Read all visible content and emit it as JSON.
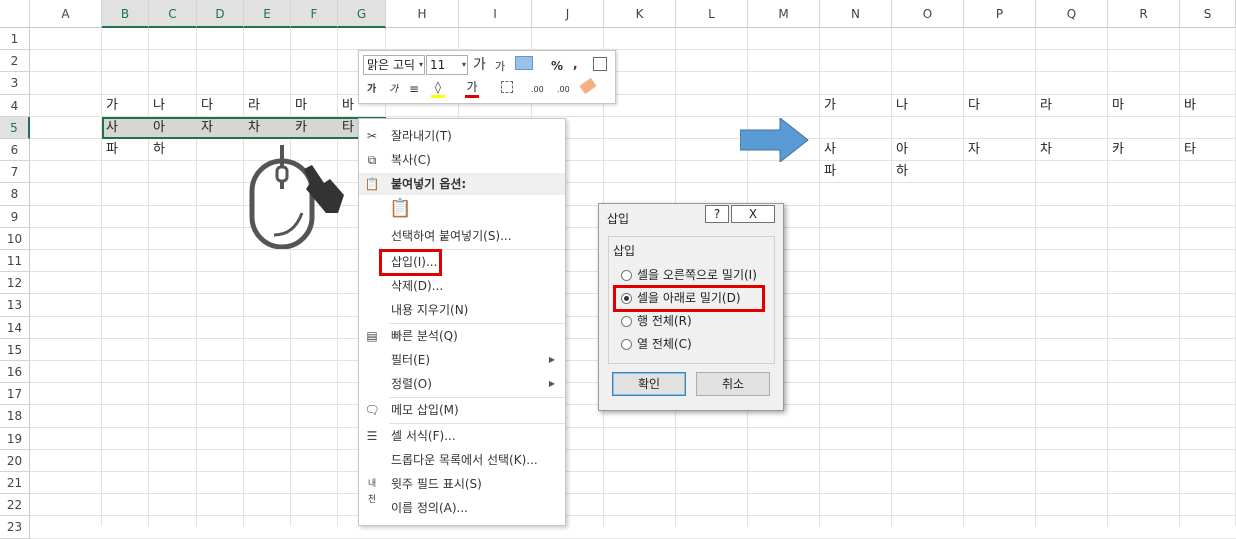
{
  "columns": [
    "A",
    "B",
    "C",
    "D",
    "E",
    "F",
    "G",
    "H",
    "I",
    "J",
    "K",
    "L",
    "M",
    "N",
    "O",
    "P",
    "Q",
    "R",
    "S"
  ],
  "rows": [
    "1",
    "2",
    "3",
    "4",
    "5",
    "6",
    "7",
    "8",
    "9",
    "10",
    "11",
    "12",
    "13",
    "14",
    "15",
    "16",
    "17",
    "18",
    "19",
    "20",
    "21",
    "22",
    "23"
  ],
  "left_data": {
    "row4": [
      "가",
      "나",
      "다",
      "라",
      "마",
      "바"
    ],
    "row5": [
      "사",
      "아",
      "자",
      "차",
      "카",
      "타"
    ],
    "row6": [
      "파",
      "하"
    ]
  },
  "right_data": {
    "row4": [
      "가",
      "나",
      "다",
      "라",
      "마",
      "바"
    ],
    "row6": [
      "사",
      "아",
      "자",
      "차",
      "카",
      "타"
    ],
    "row7": [
      "파",
      "하"
    ]
  },
  "mini_toolbar": {
    "font": "맑은 고딕",
    "size": "11",
    "grow": "가",
    "shrink": "가",
    "percent": "%",
    "comma": ",",
    "bold": "가",
    "italic": "가",
    "fontcolor": "가",
    "dec_inc": ".00",
    "dec_dec": ".00"
  },
  "context_menu": {
    "cut": "잘라내기(T)",
    "copy": "복사(C)",
    "paste_header": "붙여넣기 옵션:",
    "paste_special": "선택하여 붙여넣기(S)...",
    "insert": "삽입(I)...",
    "delete": "삭제(D)...",
    "clear": "내용 지우기(N)",
    "quick_analysis": "빠른 분석(Q)",
    "filter": "필터(E)",
    "sort": "정렬(O)",
    "comment": "메모 삽입(M)",
    "format": "셀 서식(F)...",
    "dropdown": "드롭다운 목록에서 선택(K)...",
    "phonetic": "윗주 필드 표시(S)",
    "define_name": "이름 정의(A)..."
  },
  "dialog": {
    "title": "삽입",
    "help": "?",
    "close": "X",
    "group": "삽입",
    "options": [
      "셀을 오른쪽으로 밀기(I)",
      "셀을 아래로 밀기(D)",
      "행 전체(R)",
      "열 전체(C)"
    ],
    "selected_index": 1,
    "ok": "확인",
    "cancel": "취소"
  },
  "colors": {
    "accent": "#217346",
    "highlight": "#e00000",
    "arrow": "#5b9bd5"
  }
}
